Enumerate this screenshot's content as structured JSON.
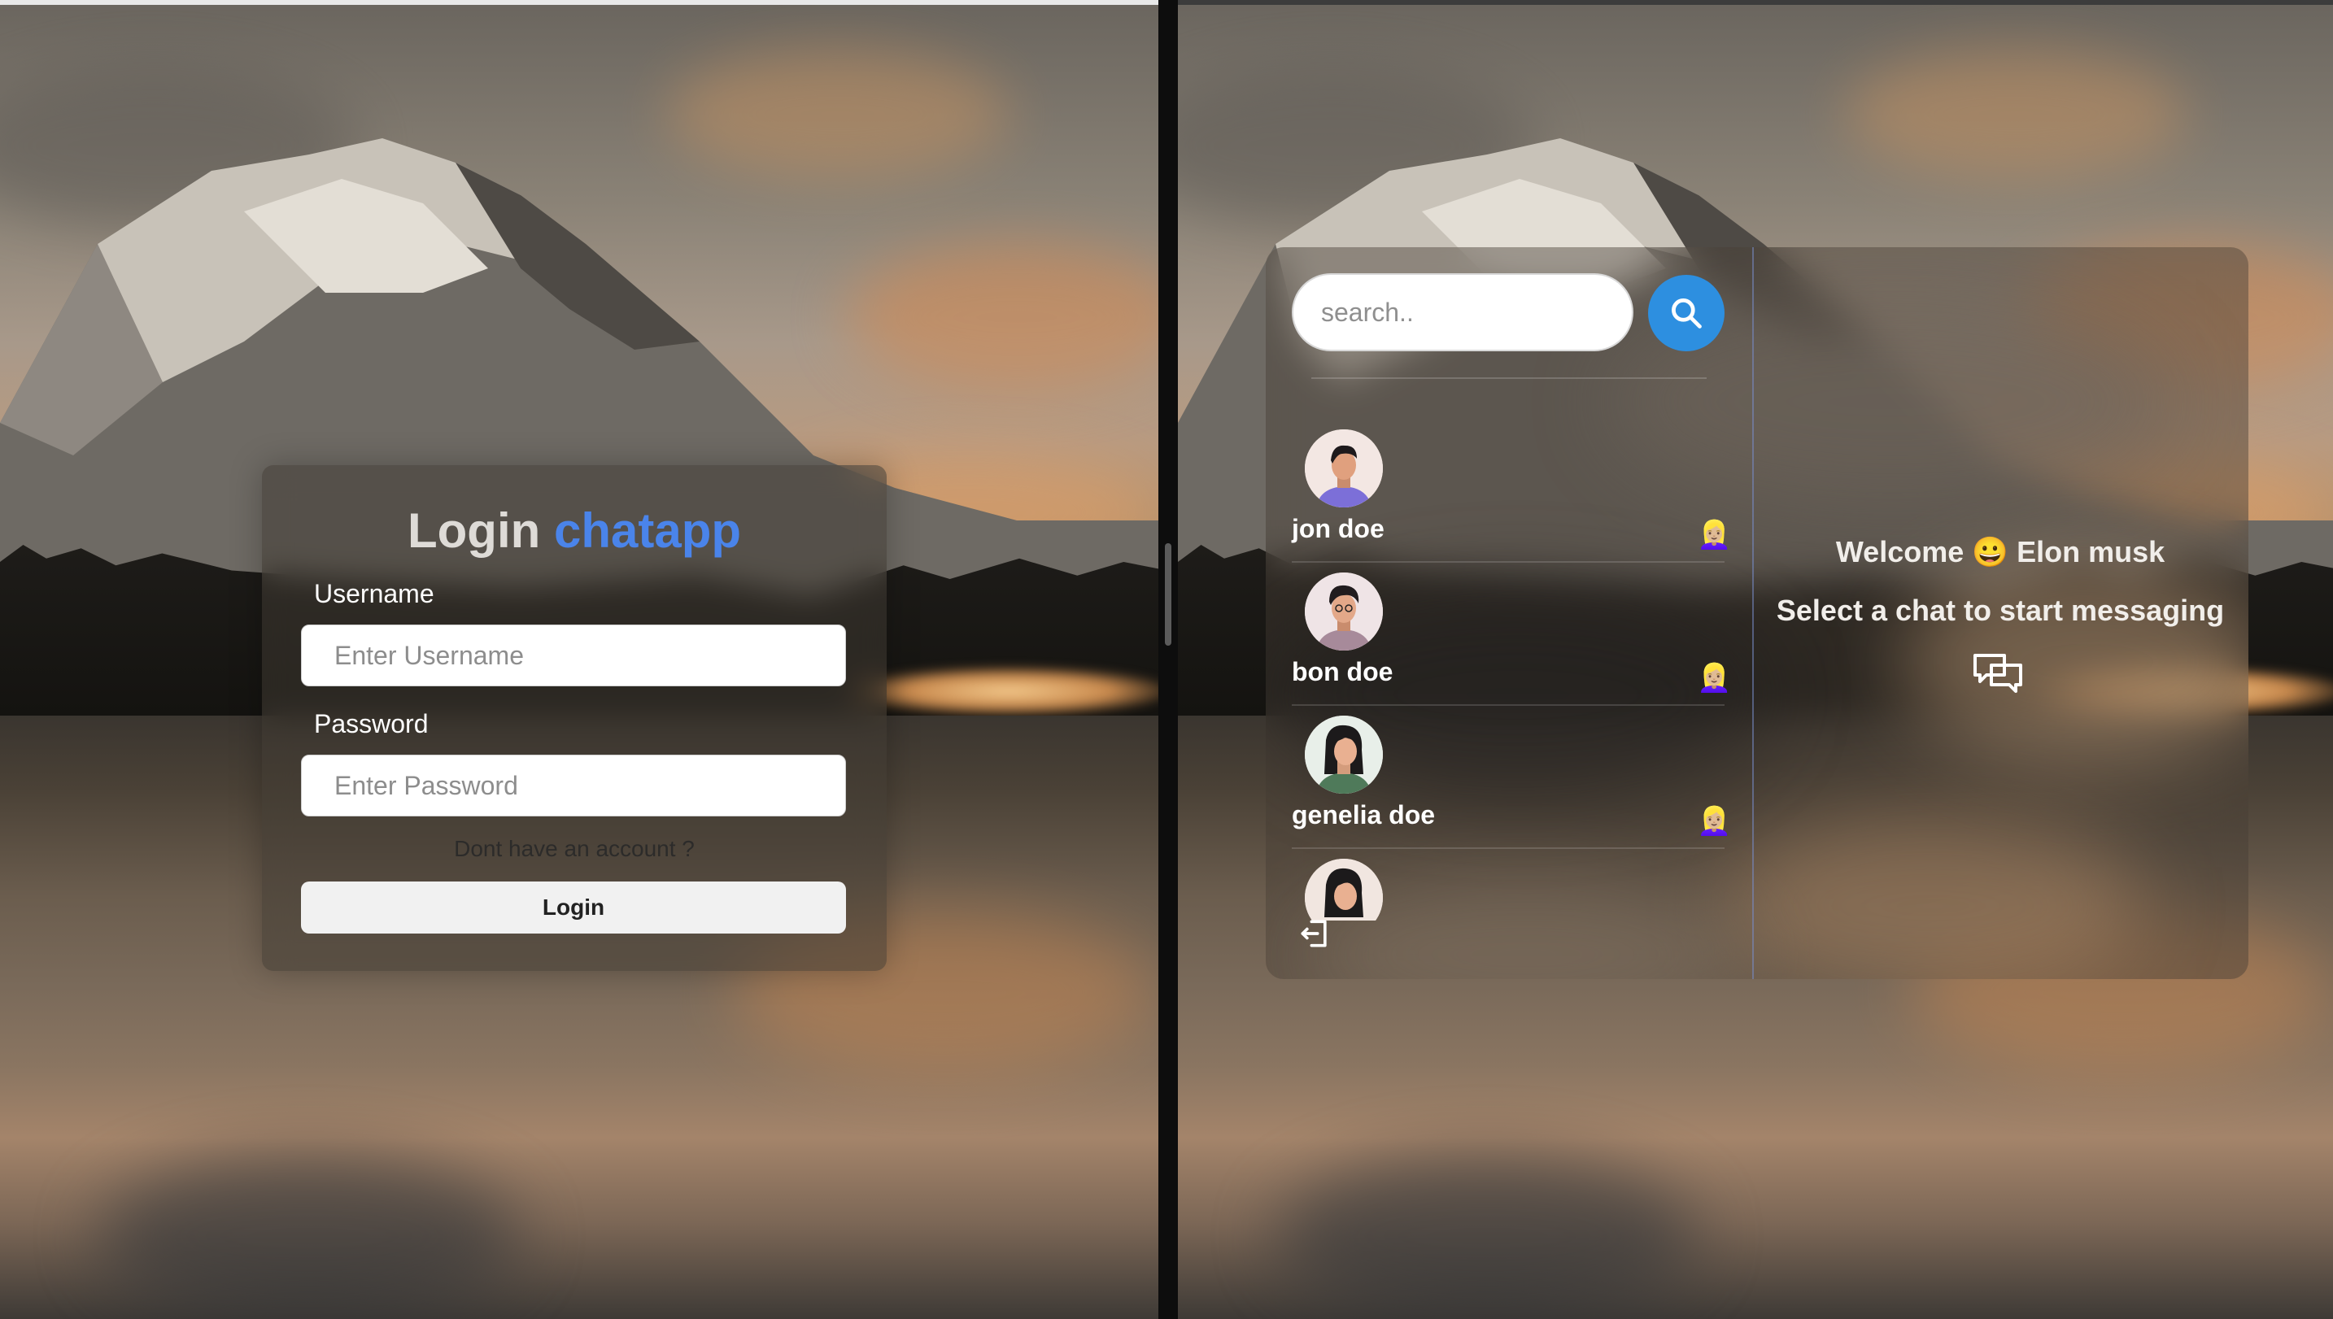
{
  "login": {
    "title": "Login",
    "brand": "chatapp",
    "username_label": "Username",
    "username_placeholder": "Enter Username",
    "password_label": "Password",
    "password_placeholder": "Enter Password",
    "signup_link": "Dont have an account ?",
    "login_button": "Login"
  },
  "chat": {
    "search_placeholder": "search..",
    "users": [
      {
        "name": "jon doe",
        "status_emoji": "👱🏼‍♀️",
        "avatar": "male-avatar"
      },
      {
        "name": "bon doe",
        "status_emoji": "👱🏼‍♀️",
        "avatar": "male-avatar"
      },
      {
        "name": "genelia doe",
        "status_emoji": "👱🏼‍♀️",
        "avatar": "female-avatar"
      },
      {
        "name": "",
        "status_emoji": "",
        "avatar": "female-avatar"
      }
    ],
    "welcome_word": "Welcome",
    "welcome_emoji": "😀",
    "welcome_user": "Elon musk",
    "select_prompt": "Select a chat to start messaging"
  },
  "colors": {
    "brand": "#4a84ea",
    "search_button": "#2d8fe0"
  }
}
